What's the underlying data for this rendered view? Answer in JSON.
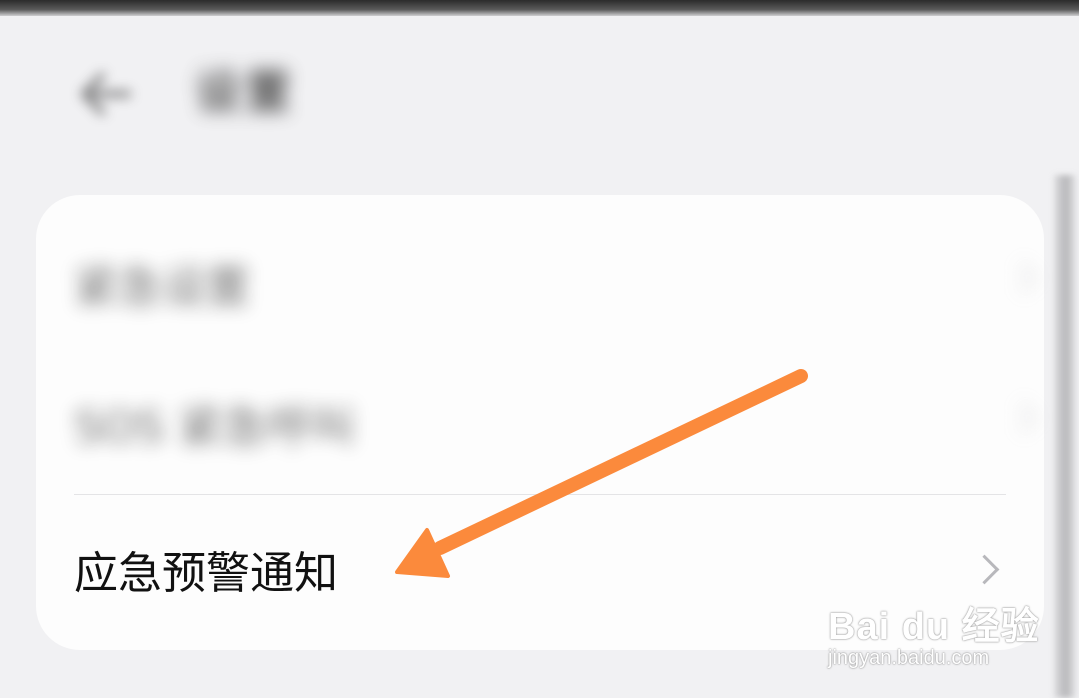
{
  "header": {
    "title": "设置",
    "back_icon": "back-arrow-icon"
  },
  "list": {
    "items": [
      {
        "label": "紧急设置",
        "blurred": true
      },
      {
        "label": "SOS 紧急呼叫",
        "blurred": true
      },
      {
        "label": "应急预警通知",
        "blurred": false
      }
    ]
  },
  "annotation": {
    "color": "#fb8a3c",
    "points_to": "应急预警通知"
  },
  "watermark": {
    "logo": "Bai du 经验",
    "url": "jingyan.baidu.com"
  }
}
